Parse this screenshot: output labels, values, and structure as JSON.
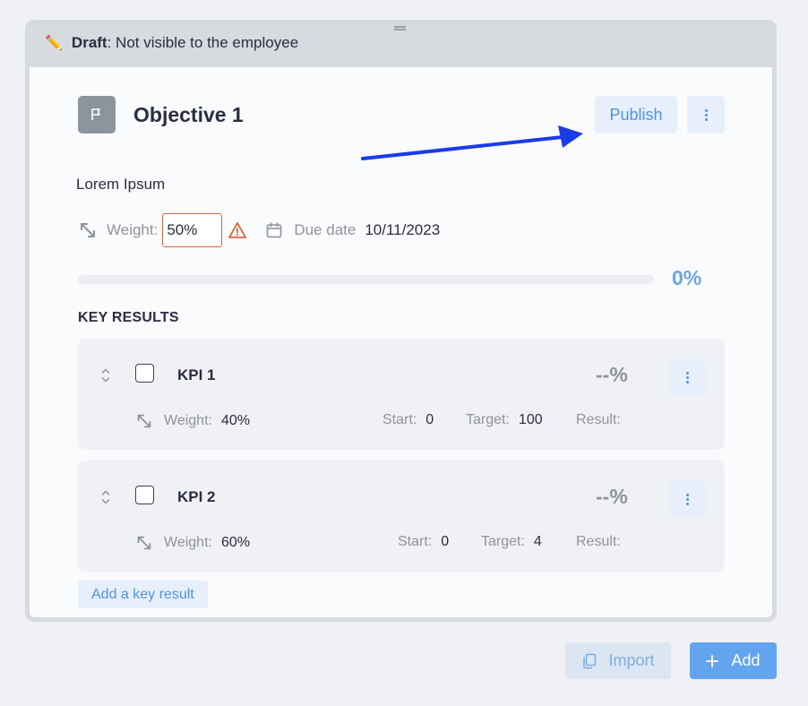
{
  "draft_banner": {
    "icon": "pencil-icon",
    "label": "Draft",
    "text": ": Not visible to the employee"
  },
  "objective": {
    "title": "Objective 1",
    "description": "Lorem Ipsum",
    "publish_label": "Publish",
    "weight_label": "Weight:",
    "weight_value": "50%",
    "due_date_label": "Due date",
    "due_date_value": "10/11/2023",
    "progress": 0,
    "progress_label": "0%"
  },
  "key_results": {
    "heading": "KEY RESULTS",
    "items": [
      {
        "name": "KPI 1",
        "pct": "--%",
        "weight_label": "Weight:",
        "weight_value": "40%",
        "start_label": "Start:",
        "start_value": "0",
        "target_label": "Target:",
        "target_value": "100",
        "result_label": "Result:"
      },
      {
        "name": "KPI 2",
        "pct": "--%",
        "weight_label": "Weight:",
        "weight_value": "60%",
        "start_label": "Start:",
        "start_value": "0",
        "target_label": "Target:",
        "target_value": "4",
        "result_label": "Result:"
      }
    ],
    "add_label": "Add a key result"
  },
  "footer": {
    "import_label": "Import",
    "add_label": "Add"
  },
  "colors": {
    "accent": "#4f94e0",
    "arrow": "#1a3ce6",
    "warning": "#d9663f"
  }
}
